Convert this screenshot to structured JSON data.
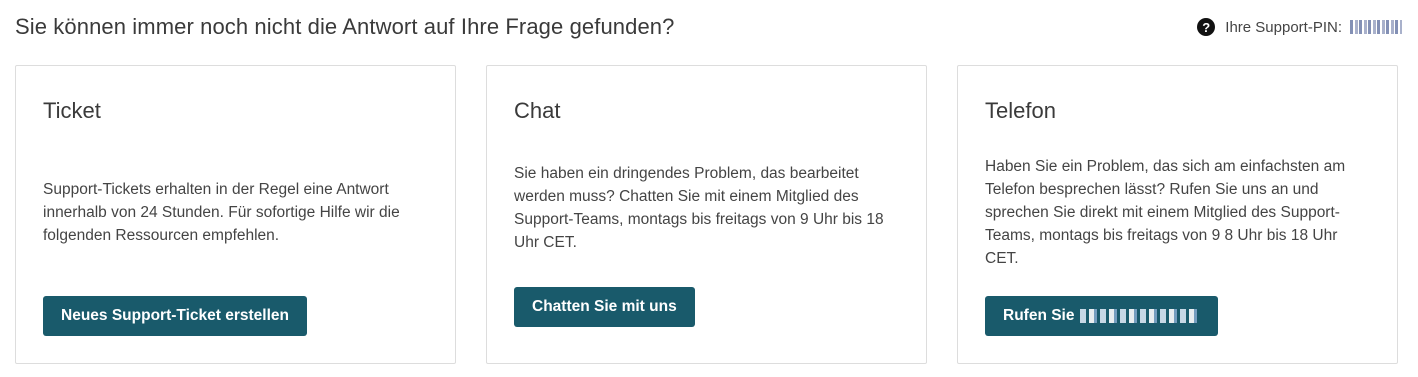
{
  "header": {
    "title": "Sie können immer noch nicht die Antwort auf Ihre Frage gefunden?",
    "pin_icon": "question-circle-icon",
    "pin_label": "Ihre Support-PIN:",
    "pin_value": ""
  },
  "cards": [
    {
      "title": "Ticket",
      "text": "Support-Tickets erhalten in der Regel eine Antwort innerhalb von 24 Stunden. Für sofortige Hilfe wir die folgenden Ressourcen empfehlen.",
      "button_label": "Neues Support-Ticket erstellen"
    },
    {
      "title": "Chat",
      "text": "Sie haben ein dringendes Problem, das bearbeitet werden muss? Chatten Sie mit einem Mitglied des Support-Teams, montags bis freitags von 9 Uhr bis 18 Uhr CET.",
      "button_label": "Chatten Sie mit uns"
    },
    {
      "title": "Telefon",
      "text": "Haben Sie ein Problem, das sich am einfachsten am Telefon besprechen lässt? Rufen Sie uns an und sprechen Sie direkt mit einem Mitglied des Support-Teams, montags bis freitags von 9 8 Uhr bis 18 Uhr CET.",
      "button_label": "Rufen Sie"
    }
  ],
  "colors": {
    "button_bg": "#195a6b",
    "border": "#dddddd",
    "text": "#444444"
  }
}
